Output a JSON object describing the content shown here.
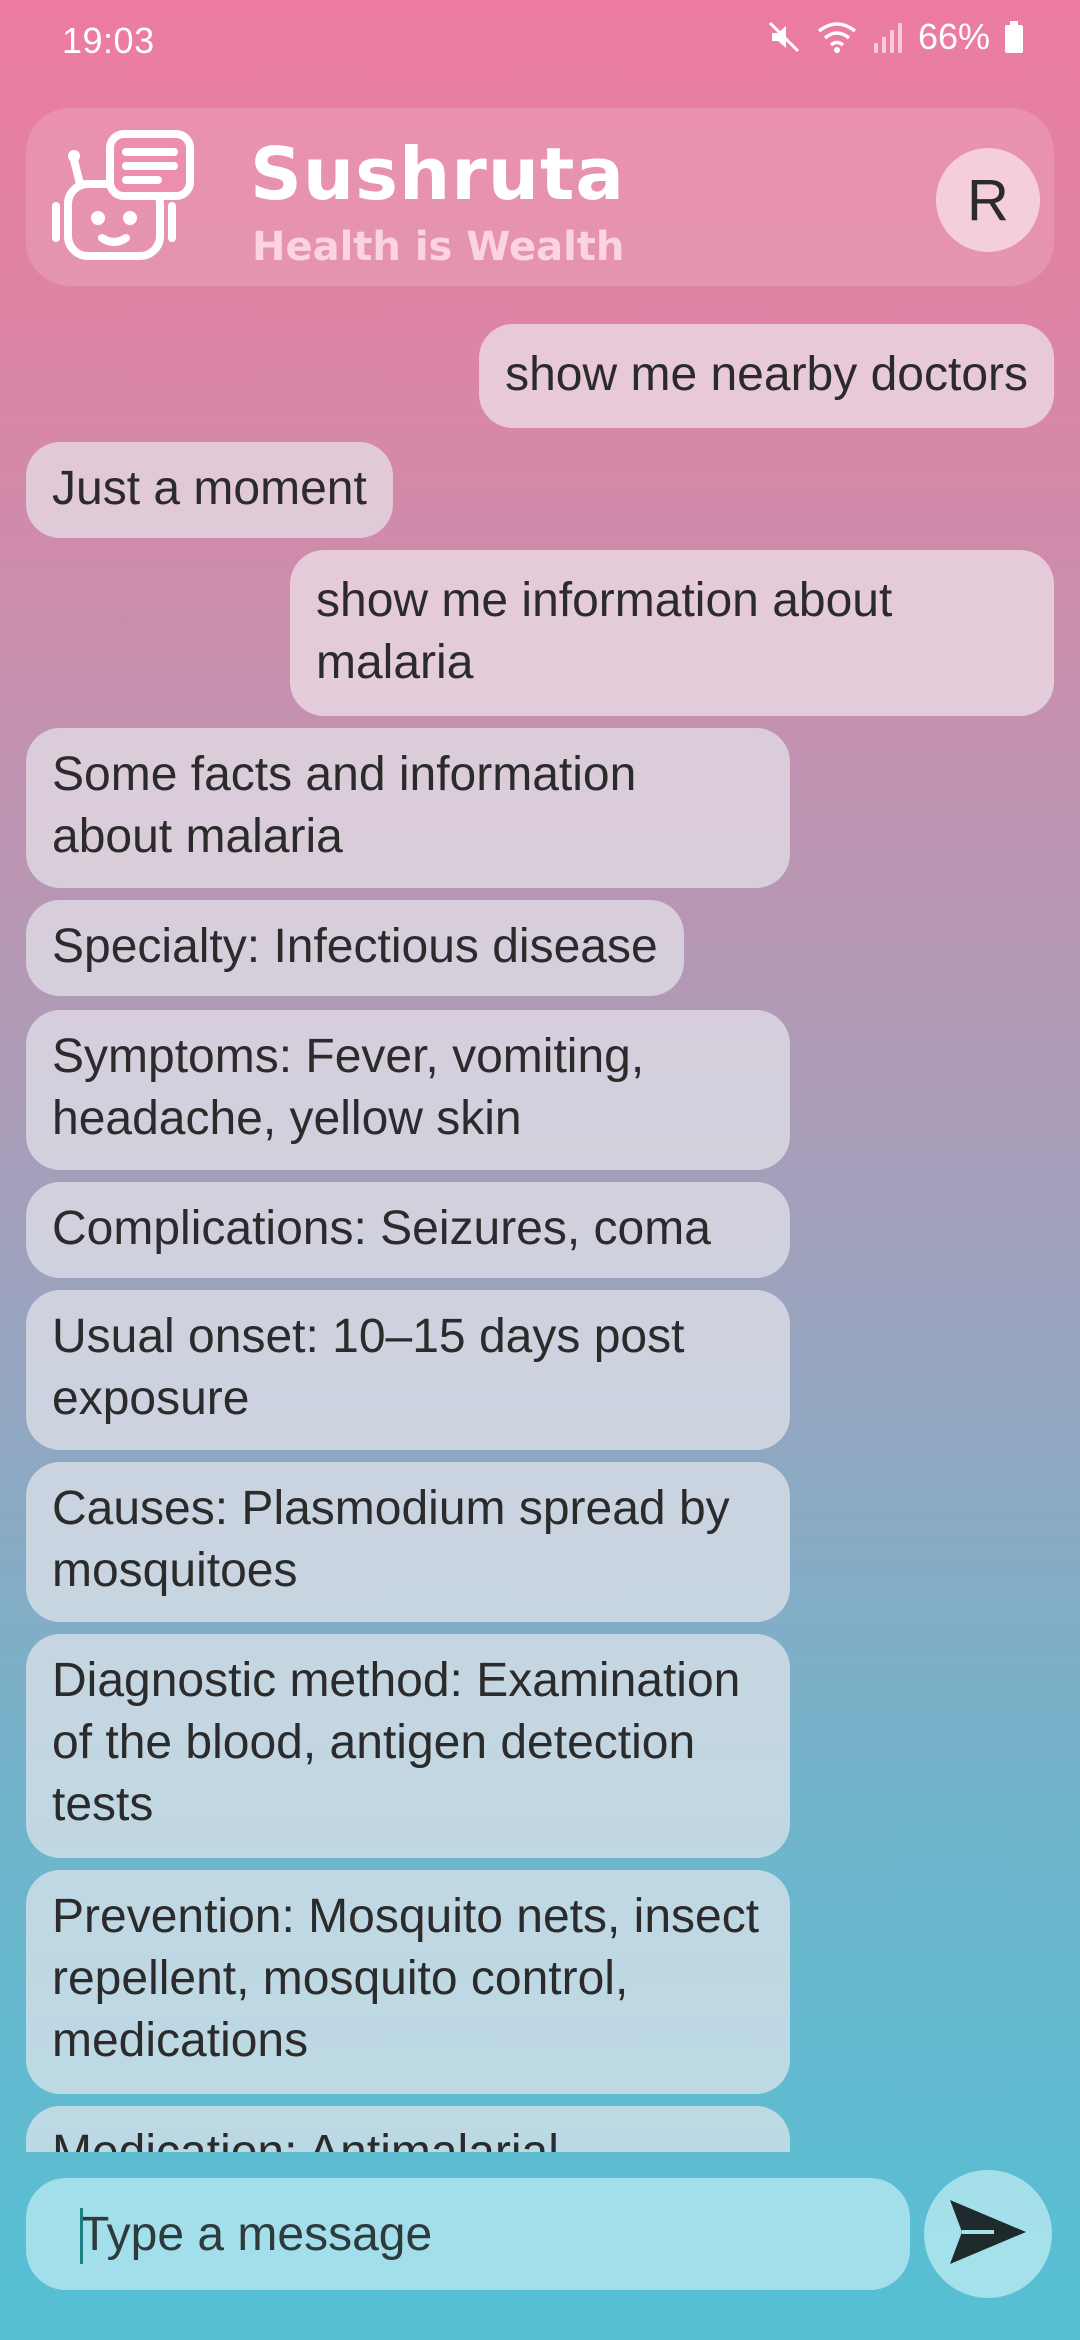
{
  "status_bar": {
    "time": "19:03",
    "battery": "66%",
    "icons": [
      "mute-icon",
      "wifi-icon",
      "signal-icon",
      "battery-icon"
    ]
  },
  "header": {
    "title": "Sushruta",
    "subtitle": "Health is Wealth",
    "avatar_letter": "R",
    "logo_icon": "robot-chat-icon"
  },
  "messages": [
    {
      "role": "user",
      "text": "show me nearby doctors"
    },
    {
      "role": "bot",
      "text": "Just a moment"
    },
    {
      "role": "user",
      "text": "show me information about malaria"
    },
    {
      "role": "bot",
      "text": "Some facts and information about malaria"
    },
    {
      "role": "bot",
      "text": "Specialty:  Infectious disease"
    },
    {
      "role": "bot",
      "text": "Symptoms:  Fever, vomiting, headache, yellow skin"
    },
    {
      "role": "bot",
      "text": "Complications:  Seizures, coma"
    },
    {
      "role": "bot",
      "text": "Usual onset:  10–15 days post exposure"
    },
    {
      "role": "bot",
      "text": "Causes:   Plasmodium  spread by mosquitoes"
    },
    {
      "role": "bot",
      "text": "Diagnostic method:  Examination of the blood, antigen detection tests"
    },
    {
      "role": "bot",
      "text": "Prevention:  Mosquito nets, insect repellent, mosquito control, medications"
    },
    {
      "role": "bot",
      "text": "Medication:  Antimalarial"
    }
  ],
  "composer": {
    "placeholder": "Type a message",
    "value": "",
    "send_icon": "send-icon"
  }
}
